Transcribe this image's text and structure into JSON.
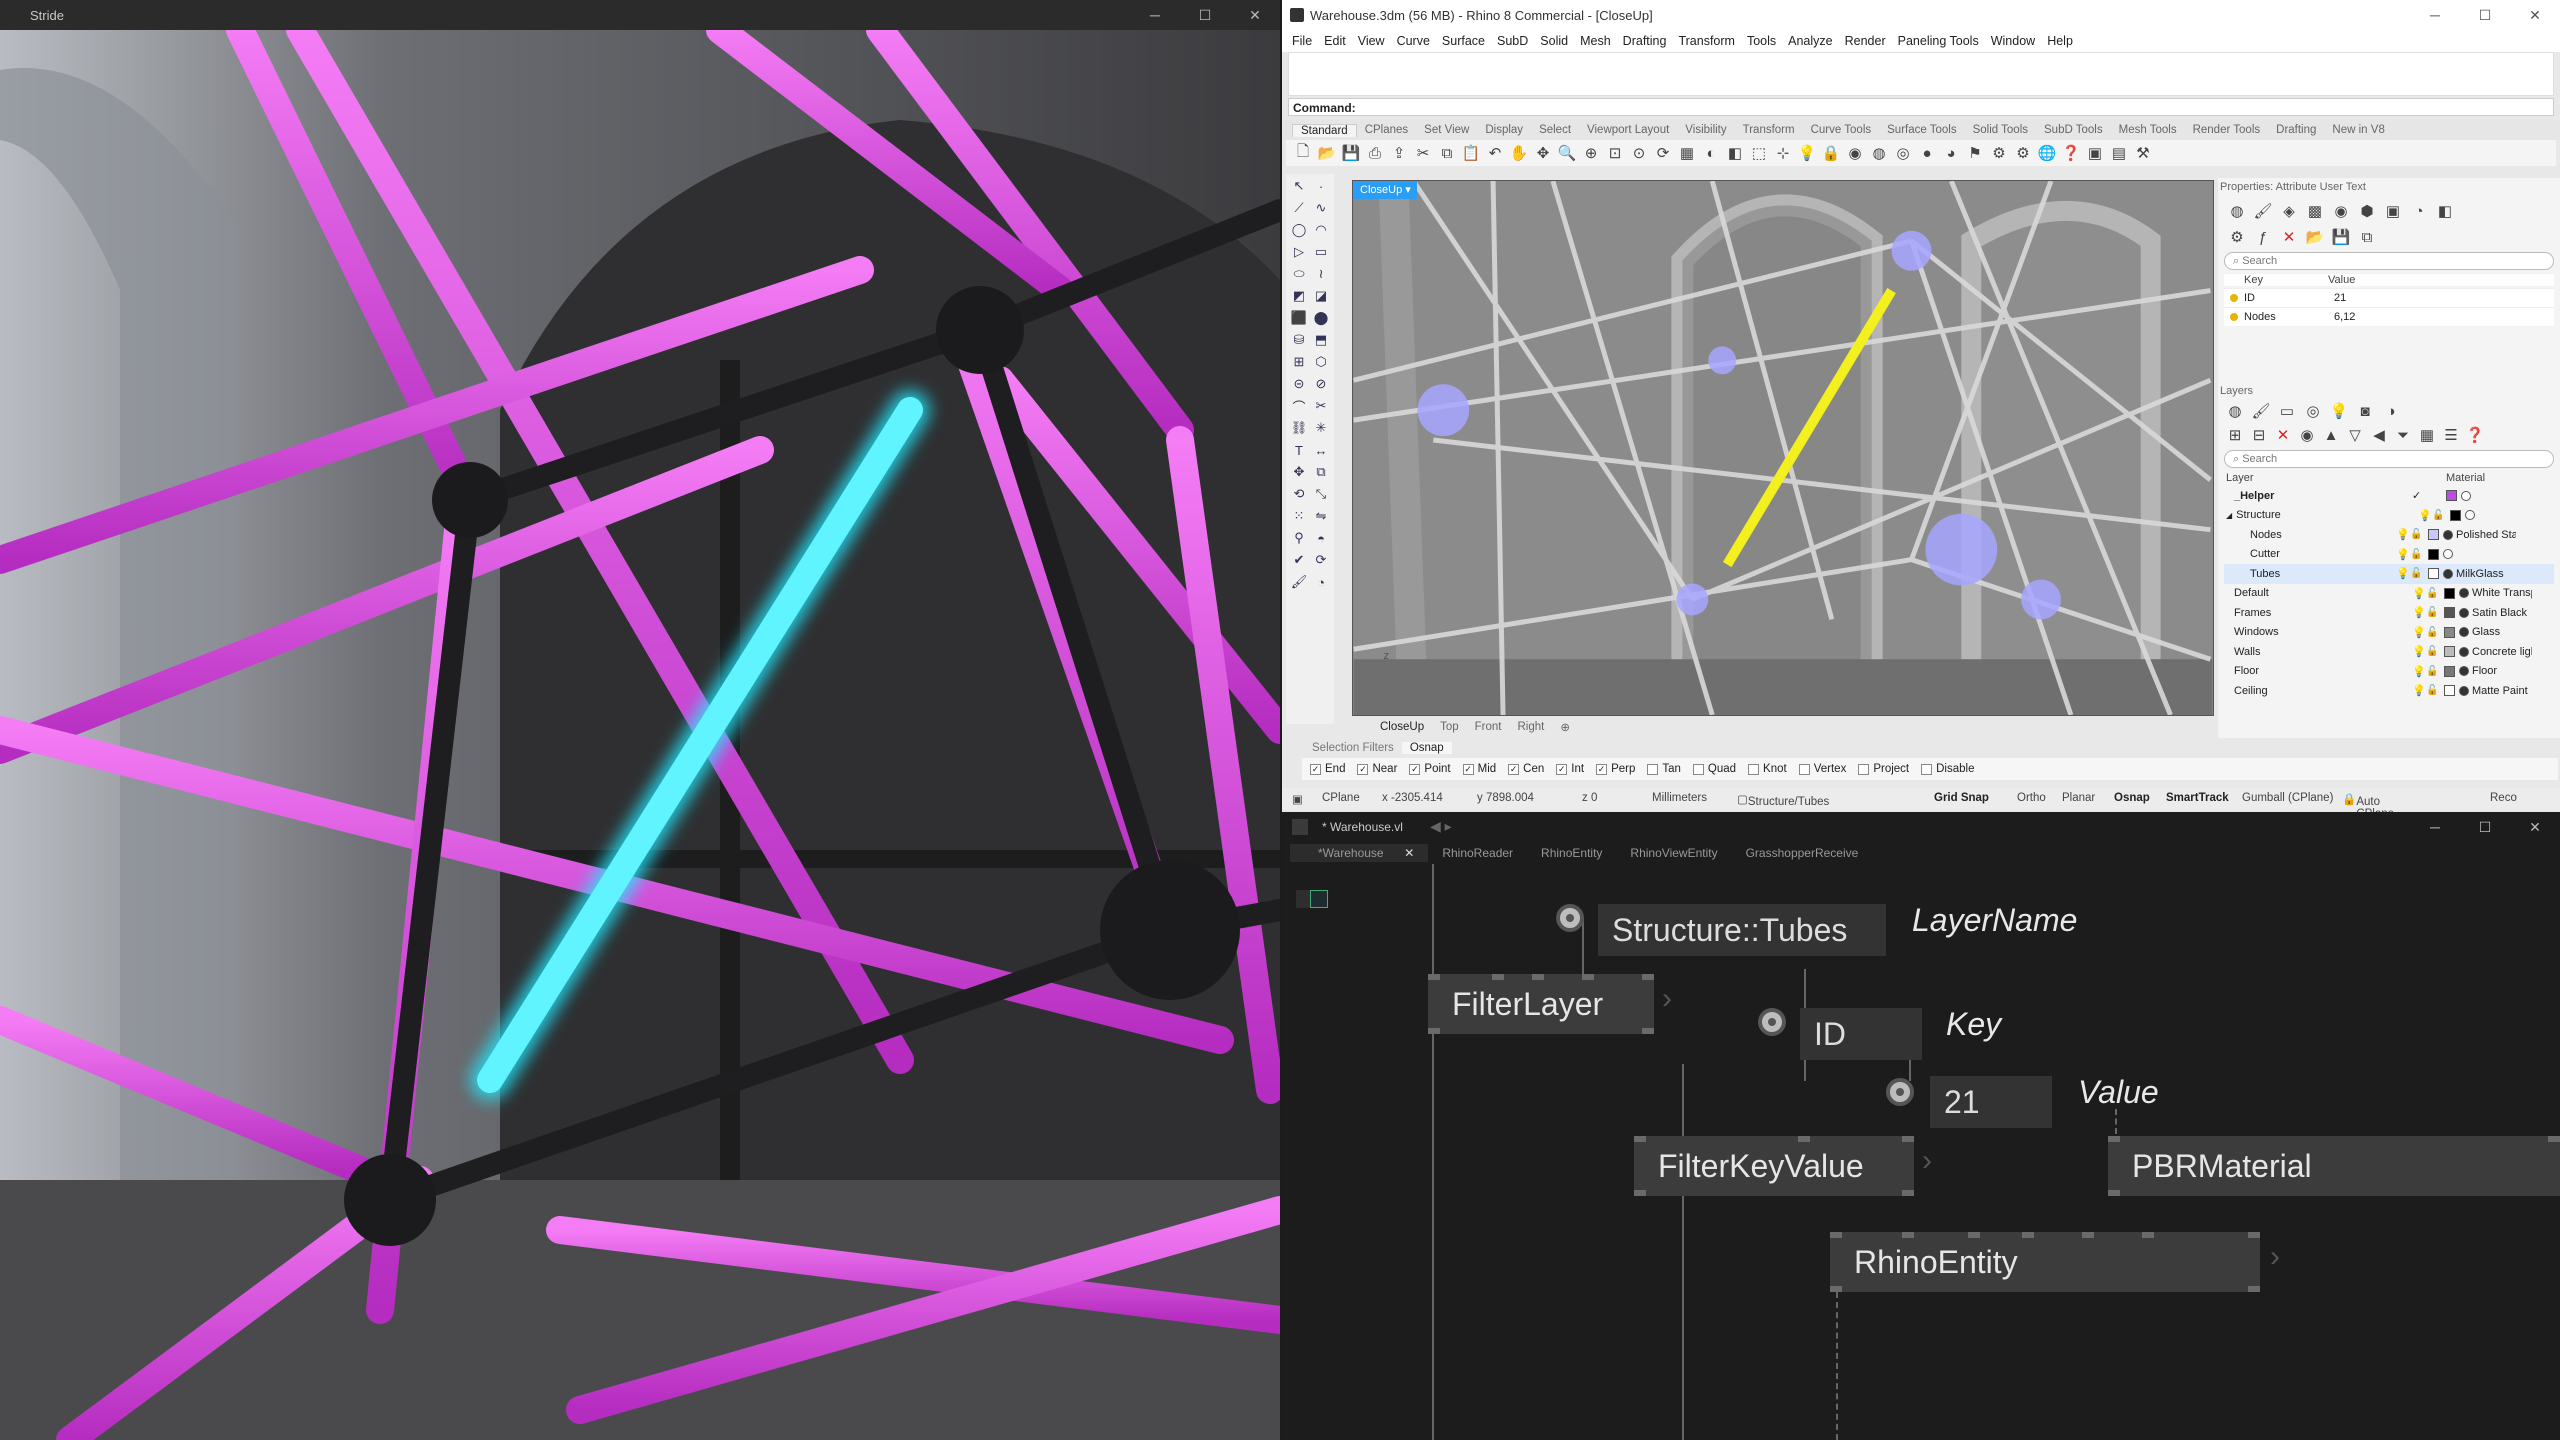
{
  "stride": {
    "title": "Stride"
  },
  "rhino": {
    "title": "Warehouse.3dm (56 MB) - Rhino 8 Commercial - [CloseUp]",
    "menu": [
      "File",
      "Edit",
      "View",
      "Curve",
      "Surface",
      "SubD",
      "Solid",
      "Mesh",
      "Drafting",
      "Transform",
      "Tools",
      "Analyze",
      "Render",
      "Paneling Tools",
      "Window",
      "Help"
    ],
    "command_label": "Command:",
    "toolbar_tabs": [
      "Standard",
      "CPlanes",
      "Set View",
      "Display",
      "Select",
      "Viewport Layout",
      "Visibility",
      "Transform",
      "Curve Tools",
      "Surface Tools",
      "Solid Tools",
      "SubD Tools",
      "Mesh Tools",
      "Render Tools",
      "Drafting",
      "New in V8"
    ],
    "viewport": {
      "name": "CloseUp",
      "tabs": [
        "CloseUp",
        "Top",
        "Front",
        "Right"
      ]
    },
    "properties": {
      "header": "Properties: Attribute User Text",
      "search_placeholder": "Search",
      "col_key": "Key",
      "col_value": "Value",
      "rows": [
        {
          "key": "ID",
          "value": "21"
        },
        {
          "key": "Nodes",
          "value": "6,12"
        }
      ]
    },
    "layers": {
      "header": "Layers",
      "search_placeholder": "Search",
      "col_layer": "Layer",
      "col_material": "Material",
      "rows": [
        {
          "name": "_Helper",
          "material": "",
          "color": "#b84fe0",
          "bold": true,
          "indent": 0
        },
        {
          "name": "Structure",
          "material": "",
          "color": "#000000",
          "bold": false,
          "indent": 0
        },
        {
          "name": "Nodes",
          "material": "Polished Stainle",
          "color": "#c8c8ff",
          "bold": false,
          "indent": 1
        },
        {
          "name": "Cutter",
          "material": "",
          "color": "#000000",
          "bold": false,
          "indent": 1
        },
        {
          "name": "Tubes",
          "material": "MilkGlass",
          "color": "#ffffff",
          "bold": false,
          "indent": 1
        },
        {
          "name": "Default",
          "material": "White Transparen",
          "color": "#000000",
          "bold": false,
          "indent": 0
        },
        {
          "name": "Frames",
          "material": "Satin Black",
          "color": "#555555",
          "bold": false,
          "indent": 0
        },
        {
          "name": "Windows",
          "material": "Glass",
          "color": "#888888",
          "bold": false,
          "indent": 0
        },
        {
          "name": "Walls",
          "material": "Concrete light",
          "color": "#bbbbbb",
          "bold": false,
          "indent": 0
        },
        {
          "name": "Floor",
          "material": "Floor",
          "color": "#777777",
          "bold": false,
          "indent": 0
        },
        {
          "name": "Ceiling",
          "material": "Matte Paint",
          "color": "#ffffff",
          "bold": false,
          "indent": 0
        }
      ]
    },
    "osnap_tabs": [
      "Selection Filters",
      "Osnap"
    ],
    "osnaps": [
      {
        "label": "End",
        "on": true
      },
      {
        "label": "Near",
        "on": true
      },
      {
        "label": "Point",
        "on": true
      },
      {
        "label": "Mid",
        "on": true
      },
      {
        "label": "Cen",
        "on": true
      },
      {
        "label": "Int",
        "on": true
      },
      {
        "label": "Perp",
        "on": true
      },
      {
        "label": "Tan",
        "on": false
      },
      {
        "label": "Quad",
        "on": false
      },
      {
        "label": "Knot",
        "on": false
      },
      {
        "label": "Vertex",
        "on": false
      },
      {
        "label": "Project",
        "on": false
      },
      {
        "label": "Disable",
        "on": false
      }
    ],
    "status": {
      "cplane": "CPlane",
      "x": "x -2305.414",
      "y": "y 7898.004",
      "z": "z 0",
      "units": "Millimeters",
      "layer": "Structure/Tubes",
      "grid_snap": "Grid Snap",
      "ortho": "Ortho",
      "planar": "Planar",
      "osnap": "Osnap",
      "smarttrack": "SmartTrack",
      "gumball": "Gumball (CPlane)",
      "autocplane": "Auto CPlane (World)",
      "rec": "Reco"
    }
  },
  "vvvv": {
    "title": "* Warehouse.vl",
    "tabs": [
      "*Warehouse",
      "RhinoReader",
      "RhinoEntity",
      "RhinoViewEntity",
      "GrasshopperReceive"
    ],
    "nodes": {
      "layer_value": "Structure::Tubes",
      "layer_label": "LayerName",
      "filter_layer": "FilterLayer",
      "key_value": "ID",
      "key_label": "Key",
      "val_value": "21",
      "val_label": "Value",
      "filter_key_value": "FilterKeyValue",
      "pbr": "PBRMaterial",
      "rhino_entity": "RhinoEntity"
    }
  }
}
